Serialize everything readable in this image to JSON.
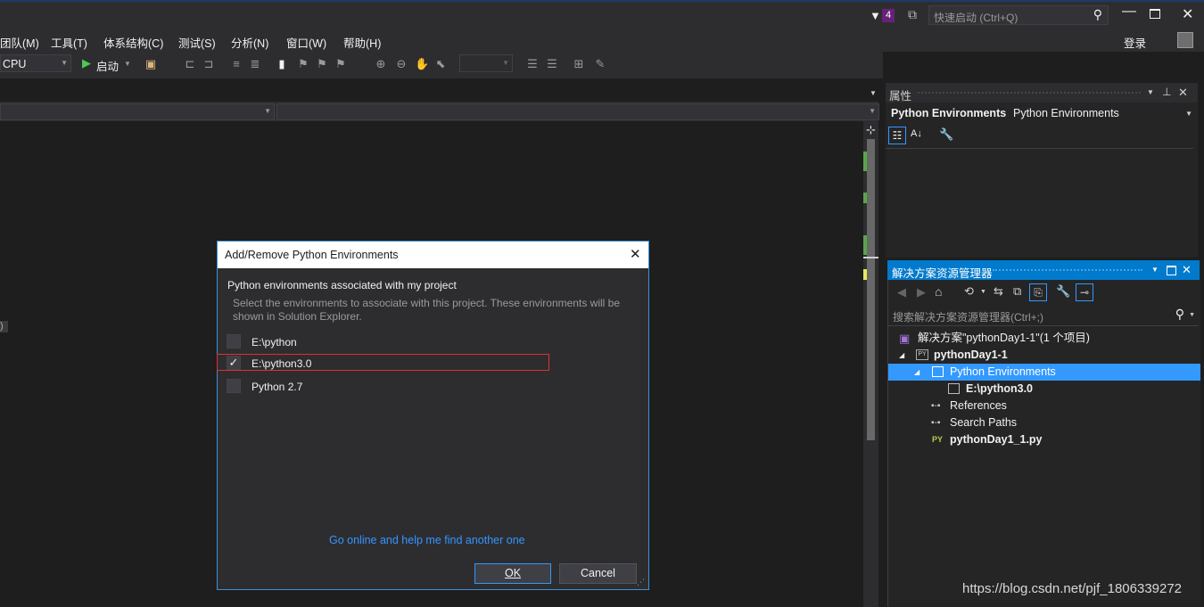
{
  "titlebar": {
    "notification_count": "4",
    "quick_launch_placeholder": "快速启动 (Ctrl+Q)"
  },
  "menubar": {
    "items": [
      "团队(M)",
      "工具(T)",
      "体系结构(C)",
      "测试(S)",
      "分析(N)",
      "窗口(W)",
      "帮助(H)"
    ],
    "login": "登录"
  },
  "toolbar": {
    "platform": "CPU",
    "start_label": "启动"
  },
  "editor": {
    "margin_text": ")"
  },
  "properties": {
    "title": "属性",
    "object_name": "Python Environments",
    "object_type": "Python Environments"
  },
  "solution_explorer": {
    "title": "解决方案资源管理器",
    "search_placeholder": "搜索解决方案资源管理器(Ctrl+;)",
    "tree": [
      "解决方案\"pythonDay1-1\"(1 个项目)",
      "pythonDay1-1",
      "Python Environments",
      "E:\\python3.0",
      "References",
      "Search Paths",
      "pythonDay1_1.py"
    ]
  },
  "dialog": {
    "title": "Add/Remove Python Environments",
    "heading": "Python environments associated with my project",
    "description": "Select the environments to associate with this project. These environments will be shown in Solution Explorer.",
    "environments": [
      {
        "label": "E:\\python",
        "checked": false
      },
      {
        "label": "E:\\python3.0",
        "checked": true
      },
      {
        "label": "Python 2.7",
        "checked": false
      }
    ],
    "link": "Go online and help me find another one",
    "ok": "OK",
    "cancel": "Cancel"
  },
  "watermark": "https://blog.csdn.net/pjf_1806339272",
  "colors": {
    "accent": "#007acc",
    "selection": "#3399ff",
    "link": "#3794ff",
    "highlight_box": "#e03030"
  }
}
